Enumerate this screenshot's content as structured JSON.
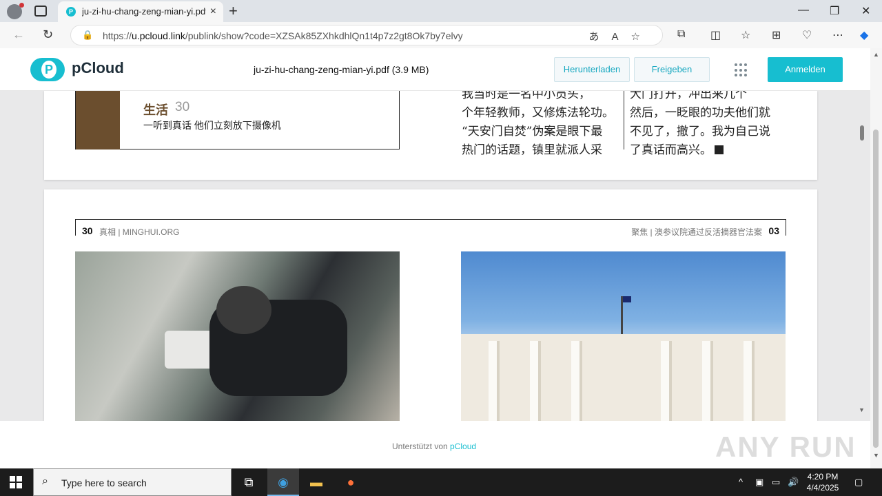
{
  "browser": {
    "tab_title": "ju-zi-hu-chang-zeng-mian-yi.pdf",
    "tab_favicon": "P",
    "url_prefix": "https://",
    "url_domain": "u.pcloud.link",
    "url_rest": "/publink/show?code=XZSAk85ZXhkdhlQn1t4p7z2gt8Ok7by7elvy",
    "new_tab": "+",
    "minimize": "—",
    "maximize": "❐",
    "close": "✕"
  },
  "header": {
    "logo_text": "pCloud",
    "file_title": "ju-zi-hu-chang-zeng-mian-yi.pdf (3.9 MB)",
    "download_label": "Herunterladen",
    "share_label": "Freigeben",
    "login_label": "Anmelden"
  },
  "page1": {
    "box_label": "生活",
    "box_number": "30",
    "box_subtitle": "一听到真话 他们立刻放下摄像机",
    "col1_lines": [
      "我当时是一名中小员头，",
      "个年轻教师，又修炼法轮功。",
      "“天安门自焚”伪案是眼下最",
      "热门的话题，镇里就派人采"
    ],
    "col2_lines": [
      "大门打开，冲出来几个",
      "然后，一眨眼的功夫他们就",
      "不见了，撤了。我为自己说",
      "了真话而高兴。"
    ]
  },
  "page2": {
    "left_page_number": "30",
    "left_running_head": "真相 | MINGHUI.ORG",
    "right_running_head": "聚焦 | 澳参议院通过反活摘器官法案",
    "right_page_number": "03"
  },
  "footer": {
    "powered_by": "Unterstützt von",
    "powered_brand": "pCloud",
    "watermark": "ANY RUN"
  },
  "taskbar": {
    "search_placeholder": "Type here to search",
    "time": "4:20 PM",
    "date": "4/4/2025"
  },
  "colors": {
    "brand": "#17bed0",
    "brown_block": "#6b4e2e"
  }
}
